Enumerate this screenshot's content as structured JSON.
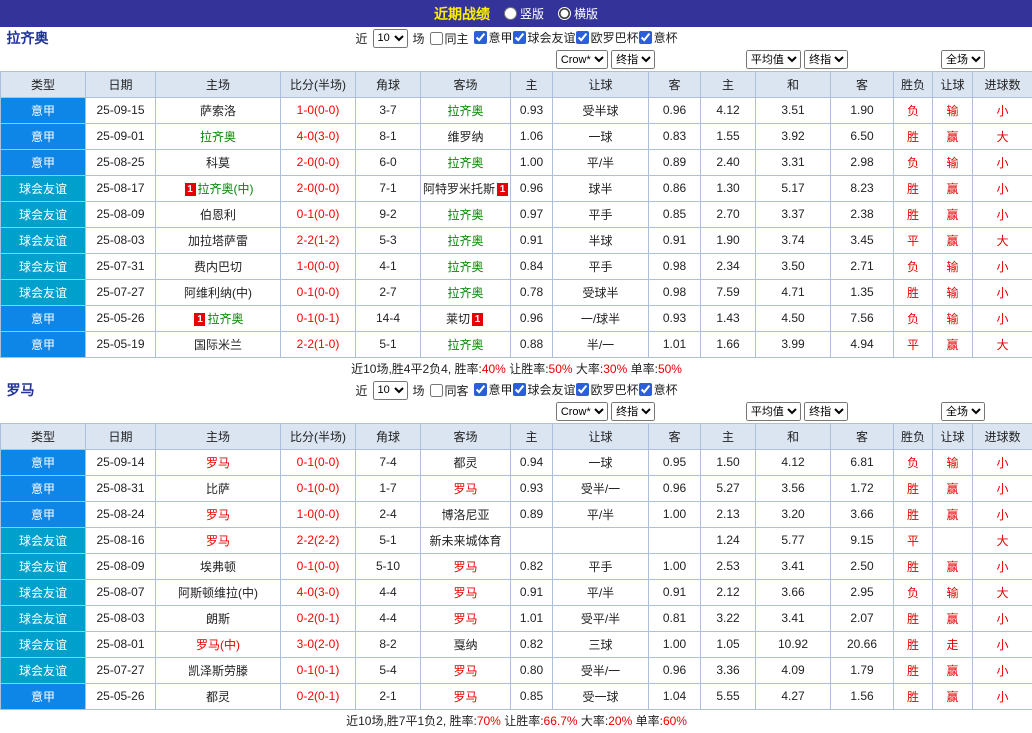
{
  "topbar": {
    "title": "近期战绩",
    "layout_options": [
      {
        "label": "竖版",
        "selected": false
      },
      {
        "label": "横版",
        "selected": true
      }
    ]
  },
  "table": {
    "columns": [
      "类型",
      "日期",
      "主场",
      "比分(半场)",
      "角球",
      "客场",
      "主",
      "让球",
      "客",
      "主",
      "和",
      "客",
      "胜负",
      "让球",
      "进球数"
    ],
    "selectors": {
      "company": "Crow*",
      "final_a": "终指",
      "average": "平均值",
      "final_b": "终指",
      "scope": "全场"
    }
  },
  "colors": {
    "league_type": {
      "意甲": "#0d86e8",
      "球会友谊": "#00a0cc"
    },
    "focus_team": {
      "拉齐奥": "#008800",
      "罗马": "#e60000"
    },
    "score": "#ff0000",
    "result": "#e60000"
  },
  "sections": [
    {
      "team": "拉齐奥",
      "filter": {
        "near": "近",
        "count": "10",
        "games": "场",
        "same": "同主",
        "same_checked": false,
        "leagues": [
          {
            "label": "意甲",
            "checked": true
          },
          {
            "label": "球会友谊",
            "checked": true
          },
          {
            "label": "欧罗巴杯",
            "checked": true
          },
          {
            "label": "意杯",
            "checked": true
          }
        ]
      },
      "rows": [
        {
          "type": "意甲",
          "date": "25-09-15",
          "home": "萨索洛",
          "home_badge": "",
          "home_focus": false,
          "score": "1-0(0-0)",
          "corner": "3-7",
          "away": "拉齐奥",
          "away_badge": "",
          "away_focus": true,
          "let_home": "0.93",
          "handicap": "受半球",
          "let_away": "0.96",
          "avg_home": "4.12",
          "avg_draw": "3.51",
          "avg_away": "1.90",
          "result": "负",
          "let_result": "输",
          "goals": "小"
        },
        {
          "type": "意甲",
          "date": "25-09-01",
          "home": "拉齐奥",
          "home_badge": "",
          "home_focus": true,
          "score": "4-0(3-0)",
          "corner": "8-1",
          "away": "维罗纳",
          "away_badge": "",
          "away_focus": false,
          "let_home": "1.06",
          "handicap": "一球",
          "let_away": "0.83",
          "avg_home": "1.55",
          "avg_draw": "3.92",
          "avg_away": "6.50",
          "result": "胜",
          "let_result": "赢",
          "goals": "大"
        },
        {
          "type": "意甲",
          "date": "25-08-25",
          "home": "科莫",
          "home_badge": "",
          "home_focus": false,
          "score": "2-0(0-0)",
          "corner": "6-0",
          "away": "拉齐奥",
          "away_badge": "",
          "away_focus": true,
          "let_home": "1.00",
          "handicap": "平/半",
          "let_away": "0.89",
          "avg_home": "2.40",
          "avg_draw": "3.31",
          "avg_away": "2.98",
          "result": "负",
          "let_result": "输",
          "goals": "小"
        },
        {
          "type": "球会友谊",
          "date": "25-08-17",
          "home": "拉齐奥(中)",
          "home_badge": "1",
          "home_focus": true,
          "score": "2-0(0-0)",
          "corner": "7-1",
          "away": "阿特罗米托斯",
          "away_badge": "1",
          "away_focus": false,
          "let_home": "0.96",
          "handicap": "球半",
          "let_away": "0.86",
          "avg_home": "1.30",
          "avg_draw": "5.17",
          "avg_away": "8.23",
          "result": "胜",
          "let_result": "赢",
          "goals": "小"
        },
        {
          "type": "球会友谊",
          "date": "25-08-09",
          "home": "伯恩利",
          "home_badge": "",
          "home_focus": false,
          "score": "0-1(0-0)",
          "corner": "9-2",
          "away": "拉齐奥",
          "away_badge": "",
          "away_focus": true,
          "let_home": "0.97",
          "handicap": "平手",
          "let_away": "0.85",
          "avg_home": "2.70",
          "avg_draw": "3.37",
          "avg_away": "2.38",
          "result": "胜",
          "let_result": "赢",
          "goals": "小"
        },
        {
          "type": "球会友谊",
          "date": "25-08-03",
          "home": "加拉塔萨雷",
          "home_badge": "",
          "home_focus": false,
          "score": "2-2(1-2)",
          "corner": "5-3",
          "away": "拉齐奥",
          "away_badge": "",
          "away_focus": true,
          "let_home": "0.91",
          "handicap": "半球",
          "let_away": "0.91",
          "avg_home": "1.90",
          "avg_draw": "3.74",
          "avg_away": "3.45",
          "result": "平",
          "let_result": "赢",
          "goals": "大"
        },
        {
          "type": "球会友谊",
          "date": "25-07-31",
          "home": "费内巴切",
          "home_badge": "",
          "home_focus": false,
          "score": "1-0(0-0)",
          "corner": "4-1",
          "away": "拉齐奥",
          "away_badge": "",
          "away_focus": true,
          "let_home": "0.84",
          "handicap": "平手",
          "let_away": "0.98",
          "avg_home": "2.34",
          "avg_draw": "3.50",
          "avg_away": "2.71",
          "result": "负",
          "let_result": "输",
          "goals": "小"
        },
        {
          "type": "球会友谊",
          "date": "25-07-27",
          "home": "阿维利纳(中)",
          "home_badge": "",
          "home_focus": false,
          "score": "0-1(0-0)",
          "corner": "2-7",
          "away": "拉齐奥",
          "away_badge": "",
          "away_focus": true,
          "let_home": "0.78",
          "handicap": "受球半",
          "let_away": "0.98",
          "avg_home": "7.59",
          "avg_draw": "4.71",
          "avg_away": "1.35",
          "result": "胜",
          "let_result": "输",
          "goals": "小"
        },
        {
          "type": "意甲",
          "date": "25-05-26",
          "home": "拉齐奥",
          "home_badge": "1",
          "home_focus": true,
          "score": "0-1(0-1)",
          "corner": "14-4",
          "away": "莱切",
          "away_badge": "1",
          "away_focus": false,
          "let_home": "0.96",
          "handicap": "一/球半",
          "let_away": "0.93",
          "avg_home": "1.43",
          "avg_draw": "4.50",
          "avg_away": "7.56",
          "result": "负",
          "let_result": "输",
          "goals": "小"
        },
        {
          "type": "意甲",
          "date": "25-05-19",
          "home": "国际米兰",
          "home_badge": "",
          "home_focus": false,
          "score": "2-2(1-0)",
          "corner": "5-1",
          "away": "拉齐奥",
          "away_badge": "",
          "away_focus": true,
          "let_home": "0.88",
          "handicap": "半/一",
          "let_away": "1.01",
          "avg_home": "1.66",
          "avg_draw": "3.99",
          "avg_away": "4.94",
          "result": "平",
          "let_result": "赢",
          "goals": "大"
        }
      ],
      "summary": [
        {
          "t": "近10场,胜4平2负4, 胜率:",
          "c": "k"
        },
        {
          "t": "40%",
          "c": "r"
        },
        {
          "t": " 让胜率:",
          "c": "k"
        },
        {
          "t": "50%",
          "c": "r"
        },
        {
          "t": " 大率:",
          "c": "k"
        },
        {
          "t": "30%",
          "c": "r"
        },
        {
          "t": " 单率:",
          "c": "k"
        },
        {
          "t": "50%",
          "c": "r"
        }
      ]
    },
    {
      "team": "罗马",
      "filter": {
        "near": "近",
        "count": "10",
        "games": "场",
        "same": "同客",
        "same_checked": false,
        "leagues": [
          {
            "label": "意甲",
            "checked": true
          },
          {
            "label": "球会友谊",
            "checked": true
          },
          {
            "label": "欧罗巴杯",
            "checked": true
          },
          {
            "label": "意杯",
            "checked": true
          }
        ]
      },
      "rows": [
        {
          "type": "意甲",
          "date": "25-09-14",
          "home": "罗马",
          "home_badge": "",
          "home_focus": true,
          "score": "0-1(0-0)",
          "corner": "7-4",
          "away": "都灵",
          "away_badge": "",
          "away_focus": false,
          "let_home": "0.94",
          "handicap": "一球",
          "let_away": "0.95",
          "avg_home": "1.50",
          "avg_draw": "4.12",
          "avg_away": "6.81",
          "result": "负",
          "let_result": "输",
          "goals": "小"
        },
        {
          "type": "意甲",
          "date": "25-08-31",
          "home": "比萨",
          "home_badge": "",
          "home_focus": false,
          "score": "0-1(0-0)",
          "corner": "1-7",
          "away": "罗马",
          "away_badge": "",
          "away_focus": true,
          "let_home": "0.93",
          "handicap": "受半/一",
          "let_away": "0.96",
          "avg_home": "5.27",
          "avg_draw": "3.56",
          "avg_away": "1.72",
          "result": "胜",
          "let_result": "赢",
          "goals": "小"
        },
        {
          "type": "意甲",
          "date": "25-08-24",
          "home": "罗马",
          "home_badge": "",
          "home_focus": true,
          "score": "1-0(0-0)",
          "corner": "2-4",
          "away": "博洛尼亚",
          "away_badge": "",
          "away_focus": false,
          "let_home": "0.89",
          "handicap": "平/半",
          "let_away": "1.00",
          "avg_home": "2.13",
          "avg_draw": "3.20",
          "avg_away": "3.66",
          "result": "胜",
          "let_result": "赢",
          "goals": "小"
        },
        {
          "type": "球会友谊",
          "date": "25-08-16",
          "home": "罗马",
          "home_badge": "",
          "home_focus": true,
          "score": "2-2(2-2)",
          "corner": "5-1",
          "away": "新未来城体育",
          "away_badge": "",
          "away_focus": false,
          "let_home": "",
          "handicap": "",
          "let_away": "",
          "avg_home": "1.24",
          "avg_draw": "5.77",
          "avg_away": "9.15",
          "result": "平",
          "let_result": "",
          "goals": "大"
        },
        {
          "type": "球会友谊",
          "date": "25-08-09",
          "home": "埃弗顿",
          "home_badge": "",
          "home_focus": false,
          "score": "0-1(0-0)",
          "corner": "5-10",
          "away": "罗马",
          "away_badge": "",
          "away_focus": true,
          "let_home": "0.82",
          "handicap": "平手",
          "let_away": "1.00",
          "avg_home": "2.53",
          "avg_draw": "3.41",
          "avg_away": "2.50",
          "result": "胜",
          "let_result": "赢",
          "goals": "小"
        },
        {
          "type": "球会友谊",
          "date": "25-08-07",
          "home": "阿斯顿维拉(中)",
          "home_badge": "",
          "home_focus": false,
          "score": "4-0(3-0)",
          "corner": "4-4",
          "away": "罗马",
          "away_badge": "",
          "away_focus": true,
          "let_home": "0.91",
          "handicap": "平/半",
          "let_away": "0.91",
          "avg_home": "2.12",
          "avg_draw": "3.66",
          "avg_away": "2.95",
          "result": "负",
          "let_result": "输",
          "goals": "大"
        },
        {
          "type": "球会友谊",
          "date": "25-08-03",
          "home": "朗斯",
          "home_badge": "",
          "home_focus": false,
          "score": "0-2(0-1)",
          "corner": "4-4",
          "away": "罗马",
          "away_badge": "",
          "away_focus": true,
          "let_home": "1.01",
          "handicap": "受平/半",
          "let_away": "0.81",
          "avg_home": "3.22",
          "avg_draw": "3.41",
          "avg_away": "2.07",
          "result": "胜",
          "let_result": "赢",
          "goals": "小"
        },
        {
          "type": "球会友谊",
          "date": "25-08-01",
          "home": "罗马(中)",
          "home_badge": "",
          "home_focus": true,
          "score": "3-0(2-0)",
          "corner": "8-2",
          "away": "戛纳",
          "away_badge": "",
          "away_focus": false,
          "let_home": "0.82",
          "handicap": "三球",
          "let_away": "1.00",
          "avg_home": "1.05",
          "avg_draw": "10.92",
          "avg_away": "20.66",
          "result": "胜",
          "let_result": "走",
          "goals": "小"
        },
        {
          "type": "球会友谊",
          "date": "25-07-27",
          "home": "凯泽斯劳滕",
          "home_badge": "",
          "home_focus": false,
          "score": "0-1(0-1)",
          "corner": "5-4",
          "away": "罗马",
          "away_badge": "",
          "away_focus": true,
          "let_home": "0.80",
          "handicap": "受半/一",
          "let_away": "0.96",
          "avg_home": "3.36",
          "avg_draw": "4.09",
          "avg_away": "1.79",
          "result": "胜",
          "let_result": "赢",
          "goals": "小"
        },
        {
          "type": "意甲",
          "date": "25-05-26",
          "home": "都灵",
          "home_badge": "",
          "home_focus": false,
          "score": "0-2(0-1)",
          "corner": "2-1",
          "away": "罗马",
          "away_badge": "",
          "away_focus": true,
          "let_home": "0.85",
          "handicap": "受一球",
          "let_away": "1.04",
          "avg_home": "5.55",
          "avg_draw": "4.27",
          "avg_away": "1.56",
          "result": "胜",
          "let_result": "赢",
          "goals": "小"
        }
      ],
      "summary": [
        {
          "t": "近10场,胜7平1负2, 胜率:",
          "c": "k"
        },
        {
          "t": "70%",
          "c": "r"
        },
        {
          "t": " 让胜率:",
          "c": "k"
        },
        {
          "t": "66.7%",
          "c": "r"
        },
        {
          "t": " 大率:",
          "c": "k"
        },
        {
          "t": "20%",
          "c": "r"
        },
        {
          "t": " 单率:",
          "c": "k"
        },
        {
          "t": "60%",
          "c": "r"
        }
      ]
    }
  ]
}
